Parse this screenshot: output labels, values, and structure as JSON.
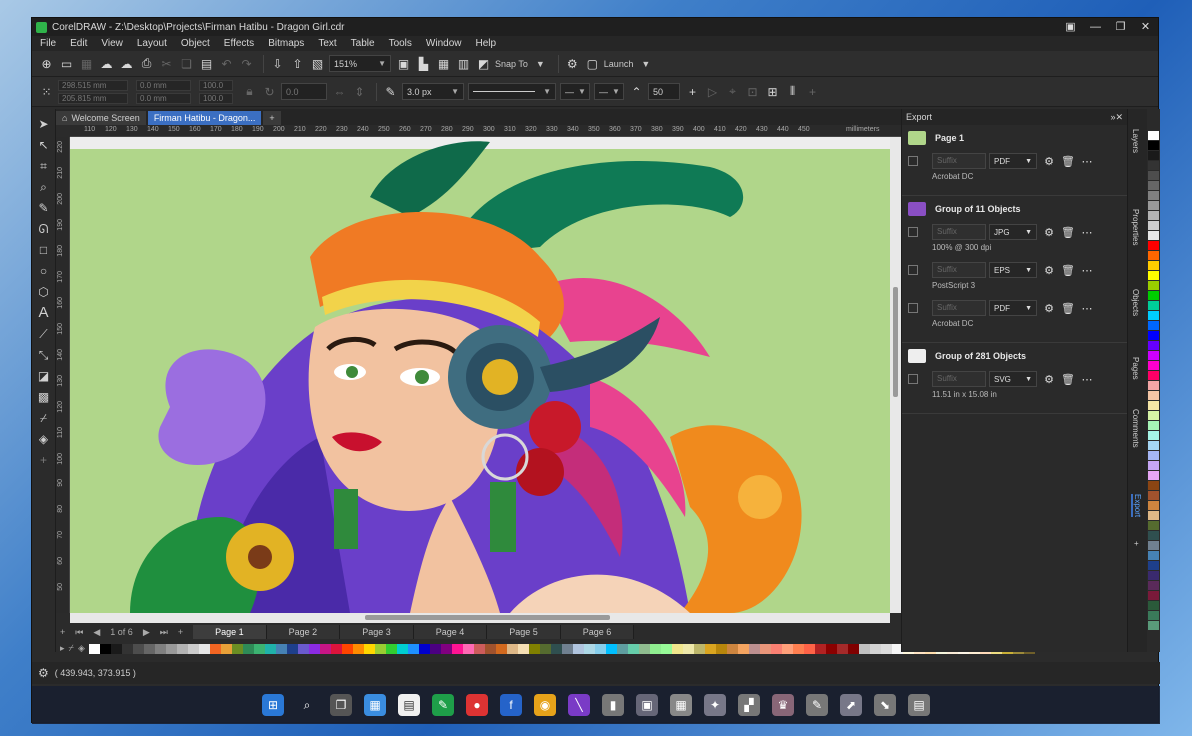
{
  "window": {
    "title": "CorelDRAW - Z:\\Desktop\\Projects\\Firman Hatibu - Dragon Girl.cdr"
  },
  "menu": [
    "File",
    "Edit",
    "View",
    "Layout",
    "Object",
    "Effects",
    "Bitmaps",
    "Text",
    "Table",
    "Tools",
    "Window",
    "Help"
  ],
  "toolbar": {
    "zoom": "151%",
    "snap_to": "Snap To",
    "launch": "Launch"
  },
  "propbar": {
    "x": "298.515 mm",
    "y": "205.815 mm",
    "w": "0.0 mm",
    "h": "0.0 mm",
    "sx": "100.0",
    "sy": "100.0",
    "angle": "0.0",
    "outline": "3.0 px",
    "miter": "50"
  },
  "tabs": {
    "welcome": "Welcome Screen",
    "doc": "Firman Hatibu - Dragon..."
  },
  "ruler": {
    "h_ticks": [
      "110",
      "120",
      "130",
      "140",
      "150",
      "160",
      "170",
      "180",
      "190",
      "200",
      "210",
      "220",
      "230",
      "240",
      "250",
      "260",
      "270",
      "280",
      "290",
      "300",
      "310",
      "320",
      "330",
      "340",
      "350",
      "360",
      "370",
      "380",
      "390",
      "400",
      "410",
      "420",
      "430",
      "440",
      "450"
    ],
    "unit": "millimeters",
    "v_ticks": [
      "220",
      "210",
      "200",
      "190",
      "180",
      "170",
      "160",
      "150",
      "140",
      "130",
      "120",
      "110",
      "100",
      "90",
      "80",
      "70",
      "60",
      "50"
    ]
  },
  "pages": {
    "counter": "1 of 6",
    "tabs": [
      "Page 1",
      "Page 2",
      "Page 3",
      "Page 4",
      "Page 5",
      "Page 6"
    ]
  },
  "status": {
    "coords": "( 439.943, 373.915 )"
  },
  "export": {
    "title": "Export",
    "sections": [
      {
        "title": "Page 1",
        "rows": [
          {
            "suffix": "Suffix",
            "format": "PDF",
            "sub": "Acrobat DC"
          }
        ]
      },
      {
        "title": "Group of 11 Objects",
        "rows": [
          {
            "suffix": "Suffix",
            "format": "JPG",
            "sub": "100% @ 300 dpi"
          },
          {
            "suffix": "Suffix",
            "format": "EPS",
            "sub": "PostScript 3"
          },
          {
            "suffix": "Suffix",
            "format": "PDF",
            "sub": "Acrobat DC"
          }
        ]
      },
      {
        "title": "Group of 281 Objects",
        "rows": [
          {
            "suffix": "Suffix",
            "format": "SVG",
            "sub": "11.51 in x 15.08 in"
          }
        ]
      }
    ]
  },
  "dock_tabs": [
    "Layers",
    "Properties",
    "Objects",
    "Pages",
    "Comments",
    "Export"
  ],
  "colors": {
    "canvas_bg": "#b0d68a",
    "accent": "#3b6fc2"
  }
}
